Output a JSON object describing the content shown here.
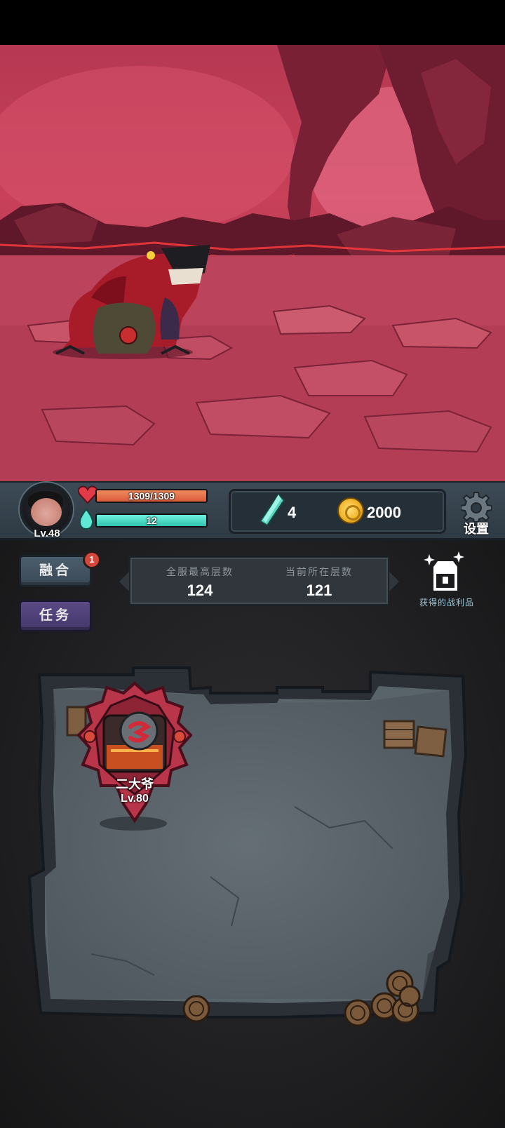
{
  "player": {
    "level": "Lv.48",
    "hp_text": "1309/1309",
    "hp_fraction": 1.0,
    "mp_text": "12",
    "mp_fraction": 1.0
  },
  "resources": {
    "crystal_count": "4",
    "gold_count": "2000"
  },
  "settings": {
    "label": "设置"
  },
  "buttons": {
    "fuse_label": "融合",
    "fuse_badge": "1",
    "task_label": "任务"
  },
  "floors": {
    "server_best_label": "全服最高层数",
    "server_best_value": "124",
    "current_label": "当前所在层数",
    "current_value": "121"
  },
  "loot": {
    "label": "获得的战利品"
  },
  "hero": {
    "name": "二大爷",
    "level": "Lv.80"
  },
  "colors": {
    "hp": "#d85a3a",
    "mp": "#31c2ae",
    "scene": "#b63852",
    "task_button": "#44386a"
  },
  "icons": [
    "heart-icon",
    "mana-drop-icon",
    "crystal-icon",
    "gold-coin-icon",
    "gear-icon",
    "treasure-chest-icon"
  ]
}
